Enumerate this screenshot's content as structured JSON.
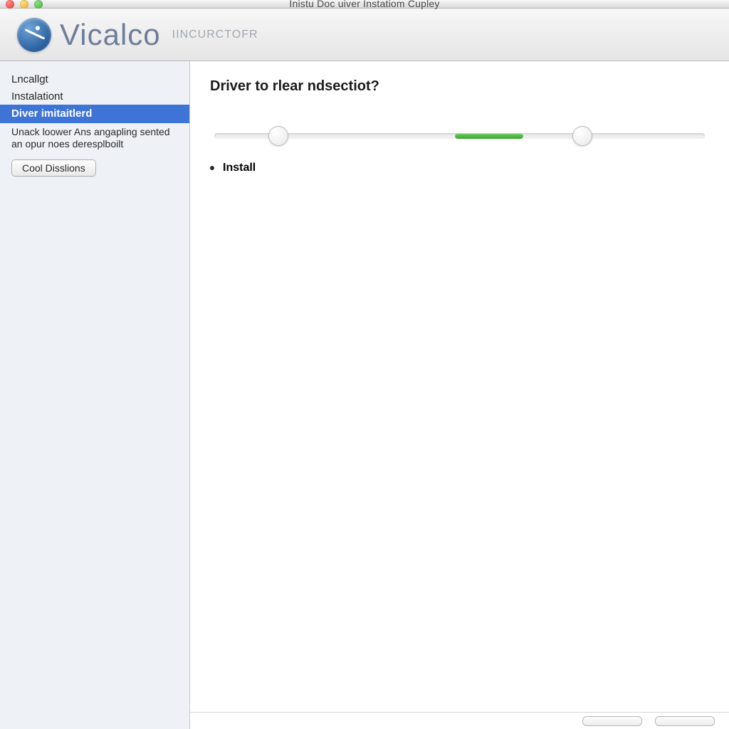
{
  "window": {
    "title": "Inistu Doc uiver Instatiom Cupley"
  },
  "header": {
    "brand": "Vicalco",
    "subtitle": "IINCURCTOFR"
  },
  "sidebar": {
    "items": [
      {
        "label": "Lncallgt",
        "selected": false
      },
      {
        "label": "Instalationt",
        "selected": false
      },
      {
        "label": "Diver imitaitlerd",
        "selected": true
      }
    ],
    "note": "Unack loower Ans angapling sented an opur noes deresplboilt",
    "button_label": "Cool Disslions"
  },
  "main": {
    "title": "Driver to rlear ndsectiot?",
    "progress": {
      "fill_start_pct": 49,
      "fill_end_pct": 63,
      "knob1_pct": 13,
      "knob2_pct": 75
    },
    "step_label": "Install"
  },
  "footer": {
    "btn1": "",
    "btn2": ""
  }
}
